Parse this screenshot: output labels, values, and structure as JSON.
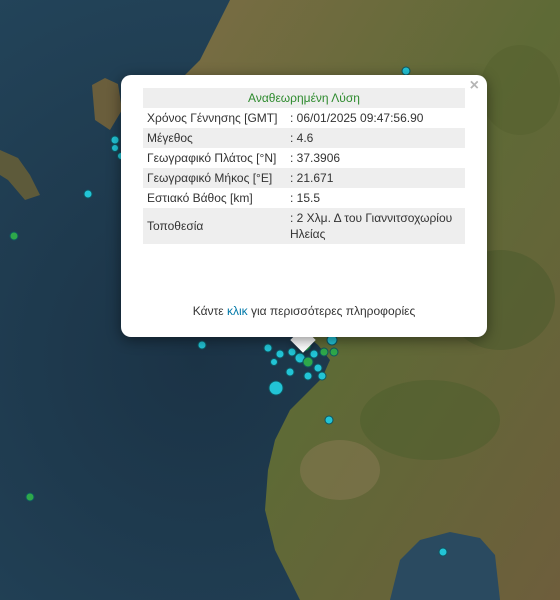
{
  "popup": {
    "close_label": "×",
    "title": "Αναθεωρημένη Λύση",
    "rows": [
      {
        "label": "Χρόνος Γέννησης [GMT]",
        "value": ": 06/01/2025 09:47:56.90"
      },
      {
        "label": "Μέγεθος",
        "value": ": 4.6"
      },
      {
        "label": "Γεωγραφικό Πλάτος [°N]",
        "value": ": 37.3906"
      },
      {
        "label": "Γεωγραφικό Μήκος [°E]",
        "value": ": 21.671"
      },
      {
        "label": "Εστιακό Βάθος [km]",
        "value": ": 15.5"
      },
      {
        "label": "Τοποθεσία",
        "value": ": 2 Χλμ. Δ του Γιαννιτσοχωρίου Ηλείας"
      }
    ],
    "footer_before": "Κάντε",
    "footer_link": "κλικ",
    "footer_after": "για περισσότερες πληροφορίες"
  },
  "colors": {
    "sea": "#1f3a4e",
    "land": "#6b5e3a",
    "marker_cyan": "#22c4d6",
    "marker_green": "#2ea84a",
    "title_green": "#2e8b2e",
    "link_blue": "#0078a8"
  }
}
